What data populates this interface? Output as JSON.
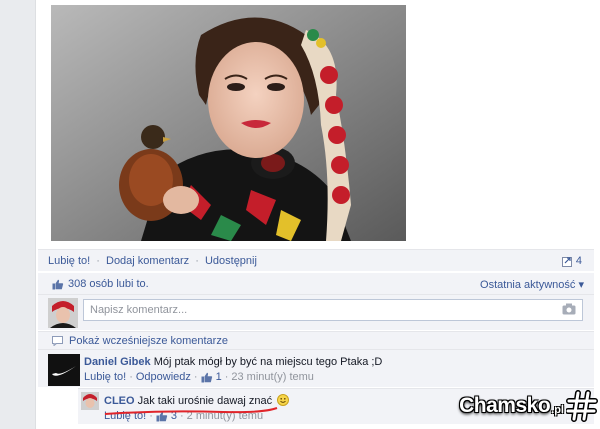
{
  "post": {
    "photo_icon": "portrait-photo-woman-with-bird"
  },
  "actions": {
    "like": "Lubię to!",
    "comment": "Dodaj komentarz",
    "share": "Udostępnij",
    "separator": "·",
    "share_count": "4"
  },
  "likes": {
    "text": "308 osób lubi to.",
    "activity_label": "Ostatnia aktywność",
    "activity_arrow": "▾"
  },
  "compose": {
    "placeholder": "Napisz komentarz..."
  },
  "previous_comments": {
    "label": "Pokaż wcześniejsze komentarze"
  },
  "comments": [
    {
      "author": "Daniel Gibek",
      "text": "Mój ptak mógł by być na miejscu tego Ptaka ;D",
      "like": "Lubię to!",
      "reply": "Odpowiedz",
      "like_count": "1",
      "time": "23 minut(y) temu"
    },
    {
      "author": "CLEO",
      "text": "Jak taki urośnie dawaj znać",
      "like": "Lubię to!",
      "like_count": "3",
      "time": "2 minut(y) temu"
    }
  ],
  "watermark": {
    "brand": "Chamsko",
    "tld": ".pl"
  },
  "colors": {
    "link": "#3b5998",
    "panel": "#f2f3f7",
    "underline": "#e0242a"
  }
}
